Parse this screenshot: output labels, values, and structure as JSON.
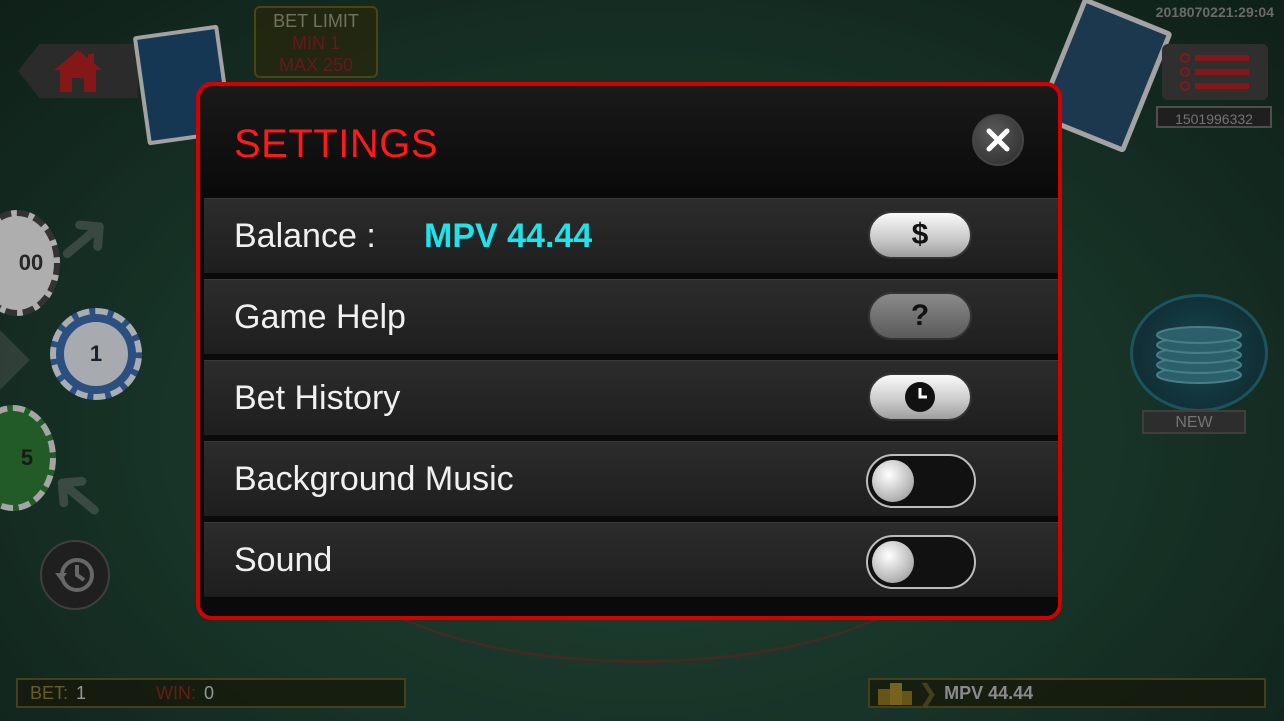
{
  "timestamp": "2018070221:29:04",
  "bet_limit": {
    "title": "BET LIMIT",
    "min": "MIN 1",
    "max": "MAX 250"
  },
  "player_id": "1501996332",
  "chips": {
    "top": "00",
    "middle": "1",
    "bottom": "5"
  },
  "new_label": "NEW",
  "bottom_bar": {
    "bet_label": "BET:",
    "bet_value": "1",
    "win_label": "WIN:",
    "win_value": "0",
    "balance": "MPV 44.44"
  },
  "settings": {
    "title": "SETTINGS",
    "balance_label": "Balance :",
    "balance_value": "MPV 44.44",
    "balance_button": "$",
    "game_help_label": "Game Help",
    "game_help_button": "?",
    "bet_history_label": "Bet History",
    "background_music_label": "Background Music",
    "background_music_on": false,
    "sound_label": "Sound",
    "sound_on": false
  },
  "colors": {
    "dialog_border": "#d40000",
    "title": "#ff1a1a",
    "balance_value": "#1fe3ea"
  },
  "icons": {
    "home": "home-icon",
    "menu": "menu-list-icon",
    "close": "close-icon",
    "history": "history-icon",
    "clock": "clock-icon",
    "coins": "coin-stack-icon"
  }
}
